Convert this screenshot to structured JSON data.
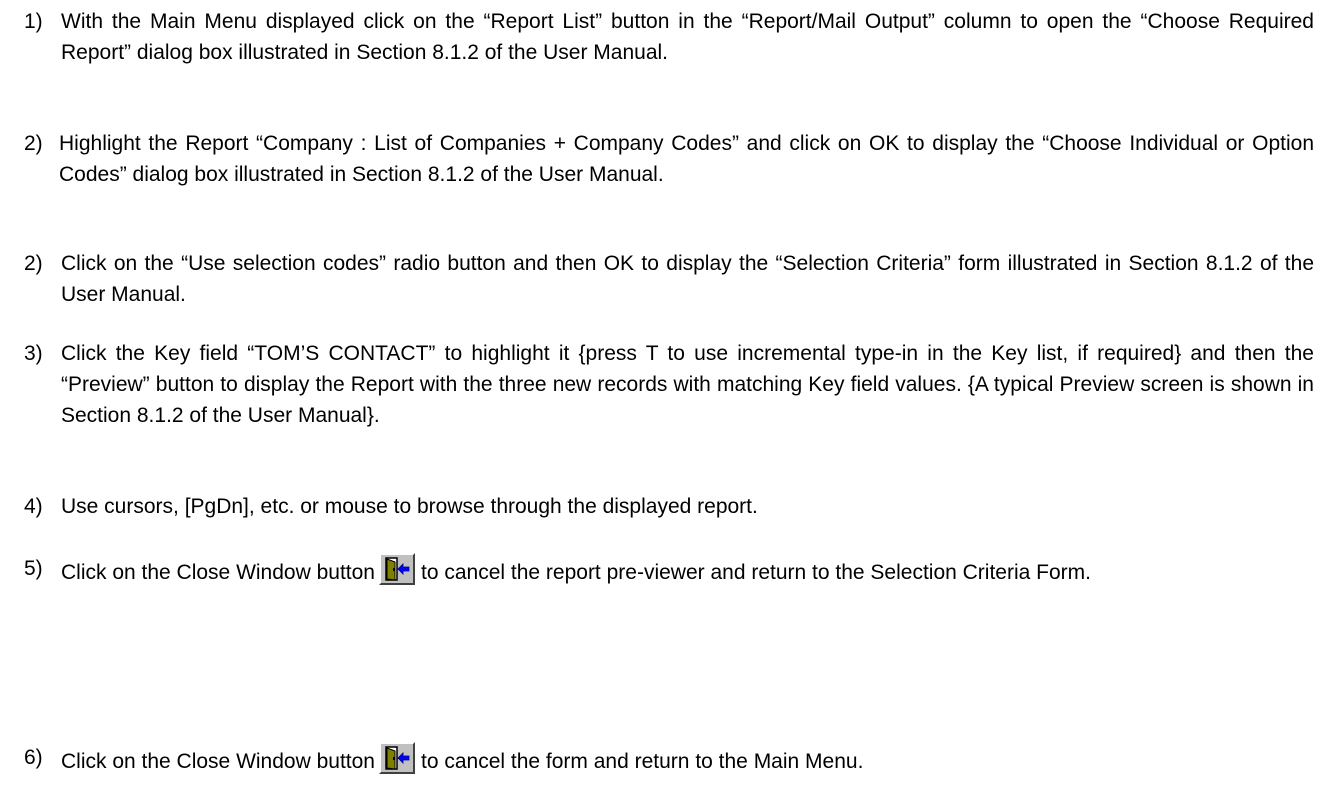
{
  "steps": [
    {
      "number": "1)",
      "text": "With the Main Menu displayed click on the “Report List” button in the “Report/Mail Output” column to open the “Choose Required Report” dialog box illustrated in Section 8.1.2 of the User Manual."
    },
    {
      "number": "2)",
      "text": "Highlight the Report  “Company : List of Companies + Company Codes” and click on OK to display the “Choose Individual or Option Codes” dialog box illustrated in Section 8.1.2 of the User Manual."
    },
    {
      "number": "2)",
      "text": "Click on the “Use selection codes” radio button and then OK to display the “Selection Criteria” form illustrated in Section 8.1.2 of the User Manual."
    },
    {
      "number": "3)",
      "text": "Click the Key field “TOM’S CONTACT” to highlight it {press T to use incremental type-in in the Key list, if required} and then the “Preview” button to display the Report with the three new records with matching Key field values. {A typical Preview screen is shown in Section 8.1.2 of the User Manual}."
    },
    {
      "number": "4)",
      "text": "Use cursors,  [PgDn], etc. or mouse to browse through the displayed report."
    },
    {
      "number": "5)",
      "text_before": "Click on the Close Window button",
      "text_after": "to cancel the report pre-viewer and return to the Selection Criteria Form."
    },
    {
      "number": "6)",
      "text_before": "Click on the Close Window button",
      "text_after": "to cancel the form and return to the Main Menu."
    }
  ],
  "icons": {
    "close_window": "close-window-icon"
  },
  "colors": {
    "text": "#000000",
    "background": "#ffffff",
    "button_face": "#c0c0c0",
    "icon_door": "#808000",
    "icon_arrow": "#0000ff"
  }
}
